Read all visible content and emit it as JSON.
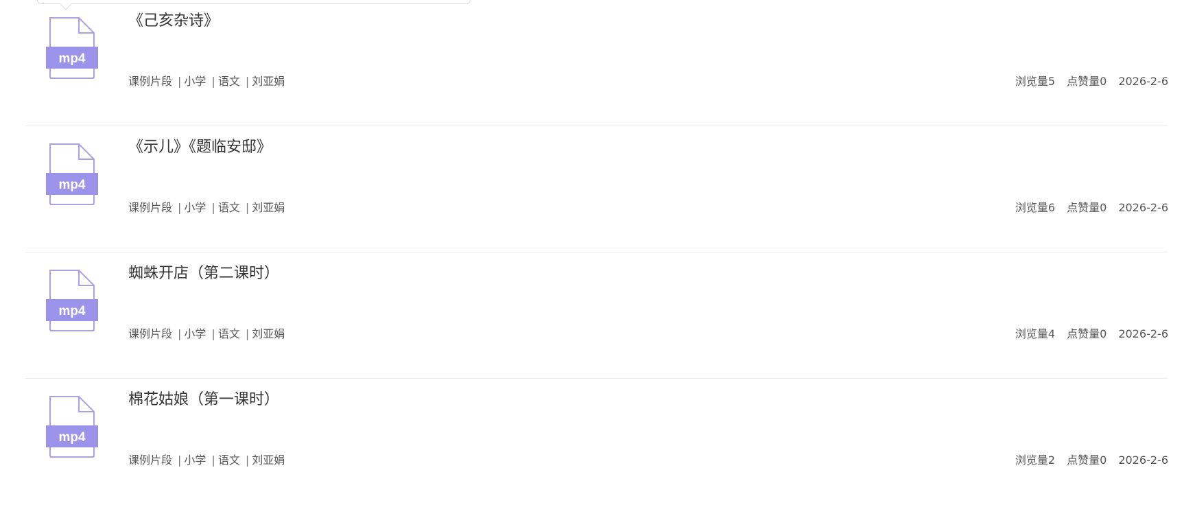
{
  "file_badge": "mp4",
  "colors": {
    "icon_accent": "#9b93ea",
    "icon_stroke": "#a6a0ee"
  },
  "items": [
    {
      "title": "《己亥杂诗》",
      "category": "课例片段",
      "level": "小学",
      "subject": "语文",
      "author": "刘亚娟",
      "views": "浏览量5",
      "likes": "点赞量0",
      "date": "2026-2-6"
    },
    {
      "title": "《示儿》《题临安邸》",
      "category": "课例片段",
      "level": "小学",
      "subject": "语文",
      "author": "刘亚娟",
      "views": "浏览量6",
      "likes": "点赞量0",
      "date": "2026-2-6"
    },
    {
      "title": "蜘蛛开店（第二课时）",
      "category": "课例片段",
      "level": "小学",
      "subject": "语文",
      "author": "刘亚娟",
      "views": "浏览量4",
      "likes": "点赞量0",
      "date": "2026-2-6"
    },
    {
      "title": "棉花姑娘（第一课时）",
      "category": "课例片段",
      "level": "小学",
      "subject": "语文",
      "author": "刘亚娟",
      "views": "浏览量2",
      "likes": "点赞量0",
      "date": "2026-2-6"
    }
  ]
}
